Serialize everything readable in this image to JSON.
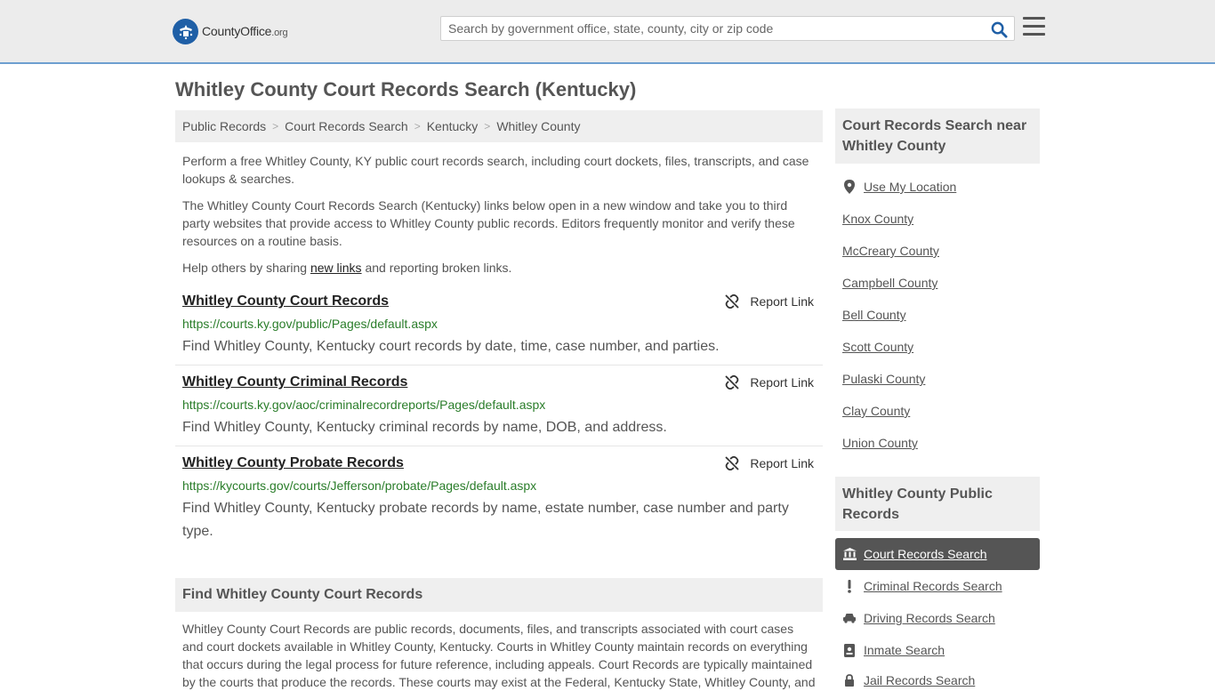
{
  "header": {
    "logo_name": "CountyOffice",
    "logo_suffix": ".org",
    "search_placeholder": "Search by government office, state, county, city or zip code"
  },
  "page_title": "Whitley County Court Records Search (Kentucky)",
  "breadcrumb": [
    "Public Records",
    "Court Records Search",
    "Kentucky",
    "Whitley County"
  ],
  "intro": {
    "p1": "Perform a free Whitley County, KY public court records search, including court dockets, files, transcripts, and case lookups & searches.",
    "p2": "The Whitley County Court Records Search (Kentucky) links below open in a new window and take you to third party websites that provide access to Whitley County public records. Editors frequently monitor and verify these resources on a routine basis.",
    "p3_before": "Help others by sharing ",
    "p3_link": "new links",
    "p3_after": " and reporting broken links."
  },
  "report_label": "Report Link",
  "records": [
    {
      "title": "Whitley County Court Records",
      "url": "https://courts.ky.gov/public/Pages/default.aspx",
      "desc": "Find Whitley County, Kentucky court records by date, time, case number, and parties."
    },
    {
      "title": "Whitley County Criminal Records",
      "url": "https://courts.ky.gov/aoc/criminalrecordreports/Pages/default.aspx",
      "desc": "Find Whitley County, Kentucky criminal records by name, DOB, and address."
    },
    {
      "title": "Whitley County Probate Records",
      "url": "https://kycourts.gov/courts/Jefferson/probate/Pages/default.aspx",
      "desc": "Find Whitley County, Kentucky probate records by name, estate number, case number and party type."
    }
  ],
  "find_section": {
    "heading": "Find Whitley County Court Records",
    "body": "Whitley County Court Records are public records, documents, files, and transcripts associated with court cases and court dockets available in Whitley County, Kentucky. Courts in Whitley County maintain records on everything that occurs during the legal process for future reference, including appeals. Court Records are typically maintained by the courts that produce the records. These courts may exist at the Federal, Kentucky State, Whitley County, and"
  },
  "sidebar": {
    "nearby_heading": "Court Records Search near Whitley County",
    "use_location": "Use My Location",
    "nearby": [
      "Knox County",
      "McCreary County",
      "Campbell County",
      "Bell County",
      "Scott County",
      "Pulaski County",
      "Clay County",
      "Union County"
    ],
    "public_heading": "Whitley County Public Records",
    "public_links": [
      {
        "label": "Court Records Search",
        "icon": "bank-icon",
        "active": true
      },
      {
        "label": "Criminal Records Search",
        "icon": "exclamation-icon",
        "active": false
      },
      {
        "label": "Driving Records Search",
        "icon": "car-icon",
        "active": false
      },
      {
        "label": "Inmate Search",
        "icon": "id-badge-icon",
        "active": false
      },
      {
        "label": "Jail Records Search",
        "icon": "lock-icon",
        "active": false
      }
    ]
  }
}
